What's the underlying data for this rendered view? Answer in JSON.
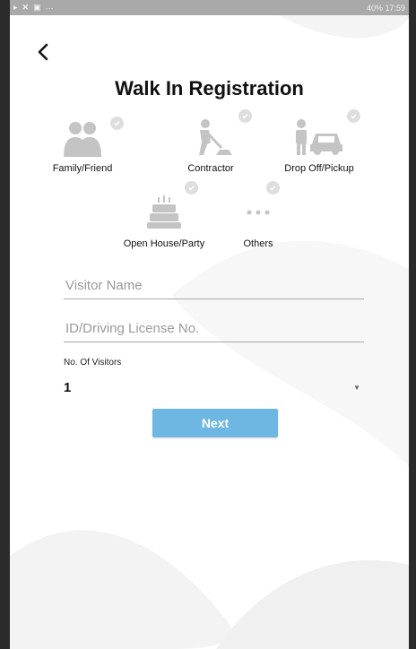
{
  "status_bar": {
    "right": "40% 17:59"
  },
  "header": {
    "title": "Walk In Registration"
  },
  "visitor_types": [
    {
      "label": "Family/Friend",
      "icon": "family-icon"
    },
    {
      "label": "Contractor",
      "icon": "contractor-icon"
    },
    {
      "label": "Drop Off/Pickup",
      "icon": "drop-off-pickup-icon"
    },
    {
      "label": "Open House/Party",
      "icon": "party-cake-icon"
    },
    {
      "label": "Others",
      "icon": "more-dots-icon"
    }
  ],
  "form": {
    "visitor_name_placeholder": "Visitor Name",
    "id_placeholder": "ID/Driving License No.",
    "visitors_label": "No. Of Visitors",
    "visitors_value": "1"
  },
  "actions": {
    "next_label": "Next"
  },
  "colors": {
    "accent": "#6fb7e3",
    "icon_gray": "#c4c4c4",
    "check_gray": "#dedede"
  }
}
